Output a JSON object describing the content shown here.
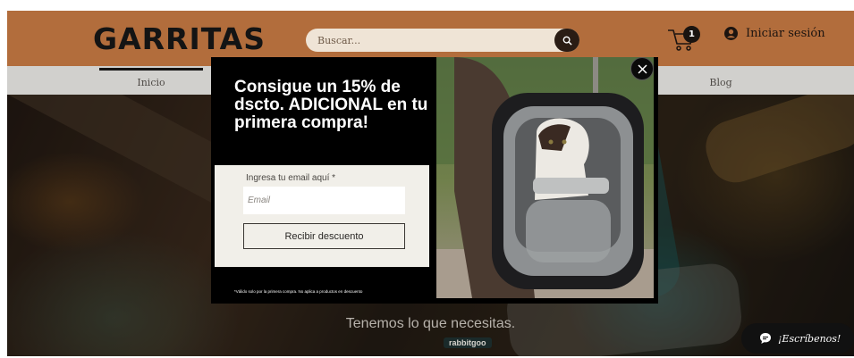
{
  "header": {
    "logo": "GARRITAS",
    "search": {
      "placeholder": "Buscar...",
      "icon": "search-icon"
    },
    "cart": {
      "icon": "cart-icon",
      "count": "1"
    },
    "login": {
      "icon": "user-icon",
      "label": "Iniciar sesión"
    }
  },
  "nav": {
    "items": [
      {
        "label": "Inicio",
        "active": true
      },
      {
        "label": "Blog",
        "active": false
      }
    ]
  },
  "hero": {
    "caption": "Tenemos lo que necesitas.",
    "brand_text": "rabbitgoo"
  },
  "chat": {
    "icon": "chat-bubble-icon",
    "label": "¡Escríbenos!"
  },
  "modal": {
    "title": "Consigue un 15% de dscto. ADICIONAL en tu primera compra!",
    "email_label": "Ingresa tu email aquí *",
    "email_placeholder": "Email",
    "submit_label": "Recibir descuento",
    "disclaimer": "*Válido solo por la primera compra. No aplica a productos en descuento",
    "close_icon": "close-icon"
  },
  "colors": {
    "header_bg": "#b26d3c",
    "nav_bg": "#d1d0cd",
    "modal_bg": "#000000",
    "form_bg": "#f1efe9",
    "chat_bg": "#111111"
  }
}
